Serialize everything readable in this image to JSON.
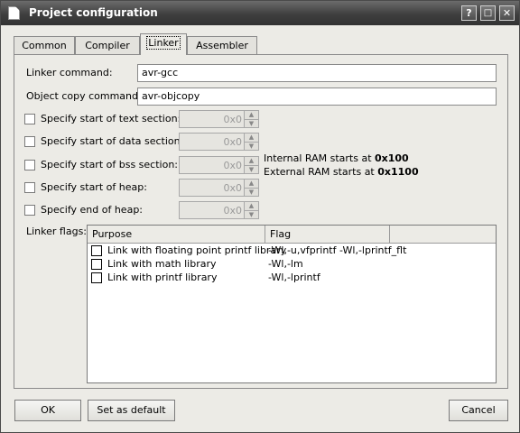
{
  "window": {
    "title": "Project configuration",
    "help_btn": "?",
    "max_btn": "□",
    "close_btn": "✕"
  },
  "tabs": [
    {
      "label": "Common",
      "active": false
    },
    {
      "label": "Compiler",
      "active": false
    },
    {
      "label": "Linker",
      "active": true
    },
    {
      "label": "Assembler",
      "active": false
    }
  ],
  "linker": {
    "command_label": "Linker command:",
    "command_value": "avr-gcc",
    "objcopy_label": "Object copy command:",
    "objcopy_value": "avr-objcopy",
    "sections": [
      {
        "label": "Specify start of text section:",
        "value": "0x0",
        "checked": false
      },
      {
        "label": "Specify start of data section:",
        "value": "0x0",
        "checked": false
      },
      {
        "label": "Specify start of bss section:",
        "value": "0x0",
        "checked": false
      },
      {
        "label": "Specify start of heap:",
        "value": "0x0",
        "checked": false
      },
      {
        "label": "Specify end of heap:",
        "value": "0x0",
        "checked": false
      }
    ],
    "internal_ram_text": "Internal RAM starts at ",
    "internal_ram_value": "0x100",
    "external_ram_text": "External RAM starts at ",
    "external_ram_value": "0x1100",
    "flags_label": "Linker flags:",
    "table": {
      "headers": [
        "Purpose",
        "Flag"
      ],
      "rows": [
        {
          "purpose": "Link with floating point printf library",
          "flag": "-Wl,-u,vfprintf -Wl,-lprintf_flt",
          "checked": false
        },
        {
          "purpose": "Link with math library",
          "flag": "-Wl,-lm",
          "checked": false
        },
        {
          "purpose": "Link with printf library",
          "flag": "-Wl,-lprintf",
          "checked": false
        }
      ]
    }
  },
  "buttons": {
    "ok": "OK",
    "set_default": "Set as default",
    "cancel": "Cancel"
  }
}
